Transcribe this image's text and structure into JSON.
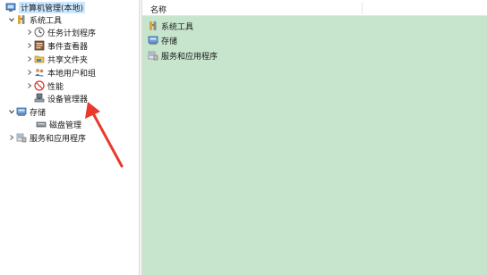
{
  "tree": {
    "root": {
      "label": "计算机管理(本地)",
      "icon": "computer-management-icon"
    },
    "nodes": [
      {
        "label": "系统工具",
        "icon": "system-tools-icon",
        "expander": "expanded"
      },
      {
        "label": "任务计划程序",
        "icon": "task-scheduler-icon",
        "expander": "collapsed"
      },
      {
        "label": "事件查看器",
        "icon": "event-viewer-icon",
        "expander": "collapsed"
      },
      {
        "label": "共享文件夹",
        "icon": "shared-folder-icon",
        "expander": "collapsed"
      },
      {
        "label": "本地用户和组",
        "icon": "users-groups-icon",
        "expander": "collapsed"
      },
      {
        "label": "性能",
        "icon": "performance-icon",
        "expander": "collapsed"
      },
      {
        "label": "设备管理器",
        "icon": "device-manager-icon",
        "expander": "none"
      },
      {
        "label": "存储",
        "icon": "storage-icon",
        "expander": "expanded"
      },
      {
        "label": "磁盘管理",
        "icon": "disk-management-icon",
        "expander": "none"
      },
      {
        "label": "服务和应用程序",
        "icon": "services-apps-icon",
        "expander": "collapsed"
      }
    ]
  },
  "list": {
    "column_header": "名称",
    "items": [
      {
        "label": "系统工具",
        "icon": "system-tools-icon"
      },
      {
        "label": "存储",
        "icon": "storage-icon"
      },
      {
        "label": "服务和应用程序",
        "icon": "services-apps-icon"
      }
    ]
  },
  "annotation": {
    "icon": "red-arrow-icon",
    "color": "#e8392b"
  },
  "colors": {
    "list_background": "#c7e5cd",
    "selection": "#cce8ff"
  }
}
